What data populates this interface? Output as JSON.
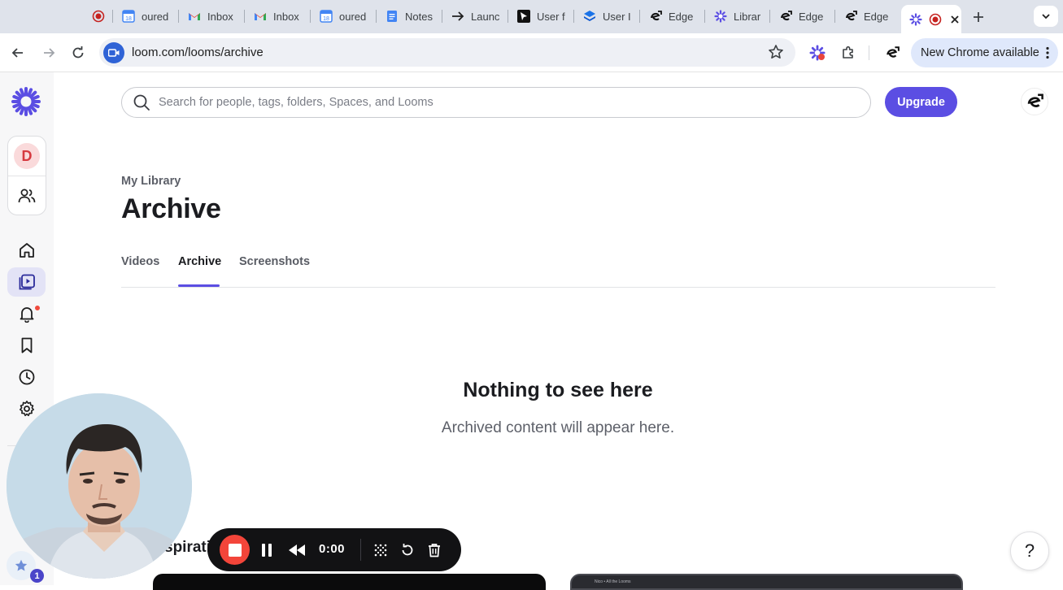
{
  "browser": {
    "tabs": [
      {
        "title": "",
        "icon": "record-icon",
        "color": "#c5221f"
      },
      {
        "title": "oured",
        "icon": "calendar-icon"
      },
      {
        "title": "Inbox",
        "icon": "gmail-icon"
      },
      {
        "title": "Inbox",
        "icon": "gmail-icon"
      },
      {
        "title": "oured",
        "icon": "calendar-icon"
      },
      {
        "title": "Notes",
        "icon": "docs-icon"
      },
      {
        "title": "Launc",
        "icon": "arrow-icon"
      },
      {
        "title": "User f",
        "icon": "cursor-icon"
      },
      {
        "title": "User I",
        "icon": "stack-icon"
      },
      {
        "title": "Edge",
        "icon": "edge-ext-icon"
      },
      {
        "title": "Librar",
        "icon": "loom-icon"
      },
      {
        "title": "Edge",
        "icon": "edge-ext-icon"
      },
      {
        "title": "Edge",
        "icon": "edge-ext-icon"
      },
      {
        "title": "",
        "icon": "loom-recording-icon",
        "active": true
      }
    ],
    "url": "loom.com/looms/archive",
    "update_label": "New Chrome available"
  },
  "app": {
    "search_placeholder": "Search for people, tags, folders, Spaces, and Looms",
    "upgrade_label": "Upgrade",
    "workspace_initial": "D",
    "accent": "#5b4ee3",
    "notification_dot": "#f04b3e"
  },
  "page": {
    "breadcrumb": "My Library",
    "title": "Archive",
    "tabs": [
      {
        "label": "Videos"
      },
      {
        "label": "Archive",
        "active": true
      },
      {
        "label": "Screenshots"
      }
    ],
    "empty_title": "Nothing to see here",
    "empty_subtitle": "Archived content will appear here.",
    "inspiration_heading": "spirati",
    "thumb_caption": "Nico • All the Looms",
    "help_label": "?"
  },
  "recorder": {
    "time": "0:00",
    "favorites_count": "1",
    "stop_color": "#f3453a"
  }
}
